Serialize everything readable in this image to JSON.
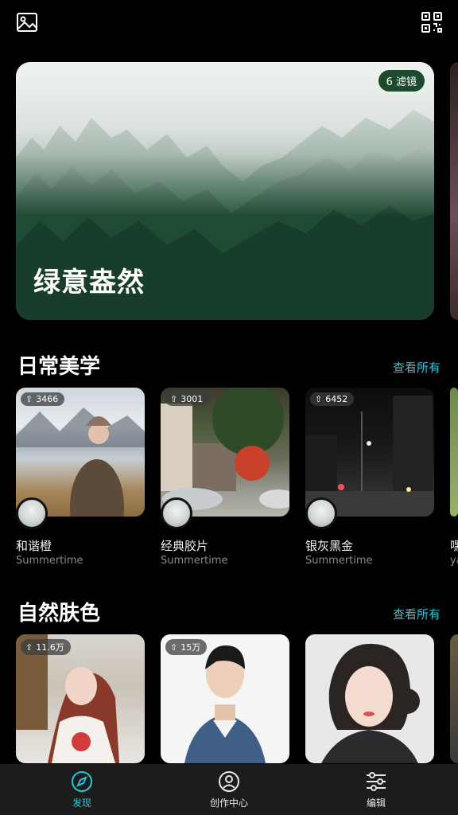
{
  "topbar": {
    "left_icon": "gallery-icon",
    "right_icon": "qr-code-icon"
  },
  "hero": {
    "badge": "6 滤镜",
    "title": "绿意盎然"
  },
  "sections": [
    {
      "title": "日常美学",
      "see_all": "查看所有",
      "cards": [
        {
          "count": "3466",
          "name": "和谐橙",
          "subtitle": "Summertime"
        },
        {
          "count": "3001",
          "name": "经典胶片",
          "subtitle": "Summertime"
        },
        {
          "count": "6452",
          "name": "银灰黑金",
          "subtitle": "Summertime"
        },
        {
          "name": "嘿",
          "subtitle": "ya"
        }
      ]
    },
    {
      "title": "自然肤色",
      "see_all": "查看所有",
      "cards": [
        {
          "count": "11.6万"
        },
        {
          "count": "15万"
        },
        {}
      ]
    }
  ],
  "bottom_nav": [
    {
      "label": "发现",
      "icon": "compass-icon",
      "active": true
    },
    {
      "label": "创作中心",
      "icon": "user-icon"
    },
    {
      "label": "编辑",
      "icon": "sliders-icon"
    }
  ],
  "colors": {
    "accent": "#27c7d9",
    "badge_bg": "#1d4a2c",
    "background": "#000000",
    "nav_bg": "#1c1c1c"
  }
}
